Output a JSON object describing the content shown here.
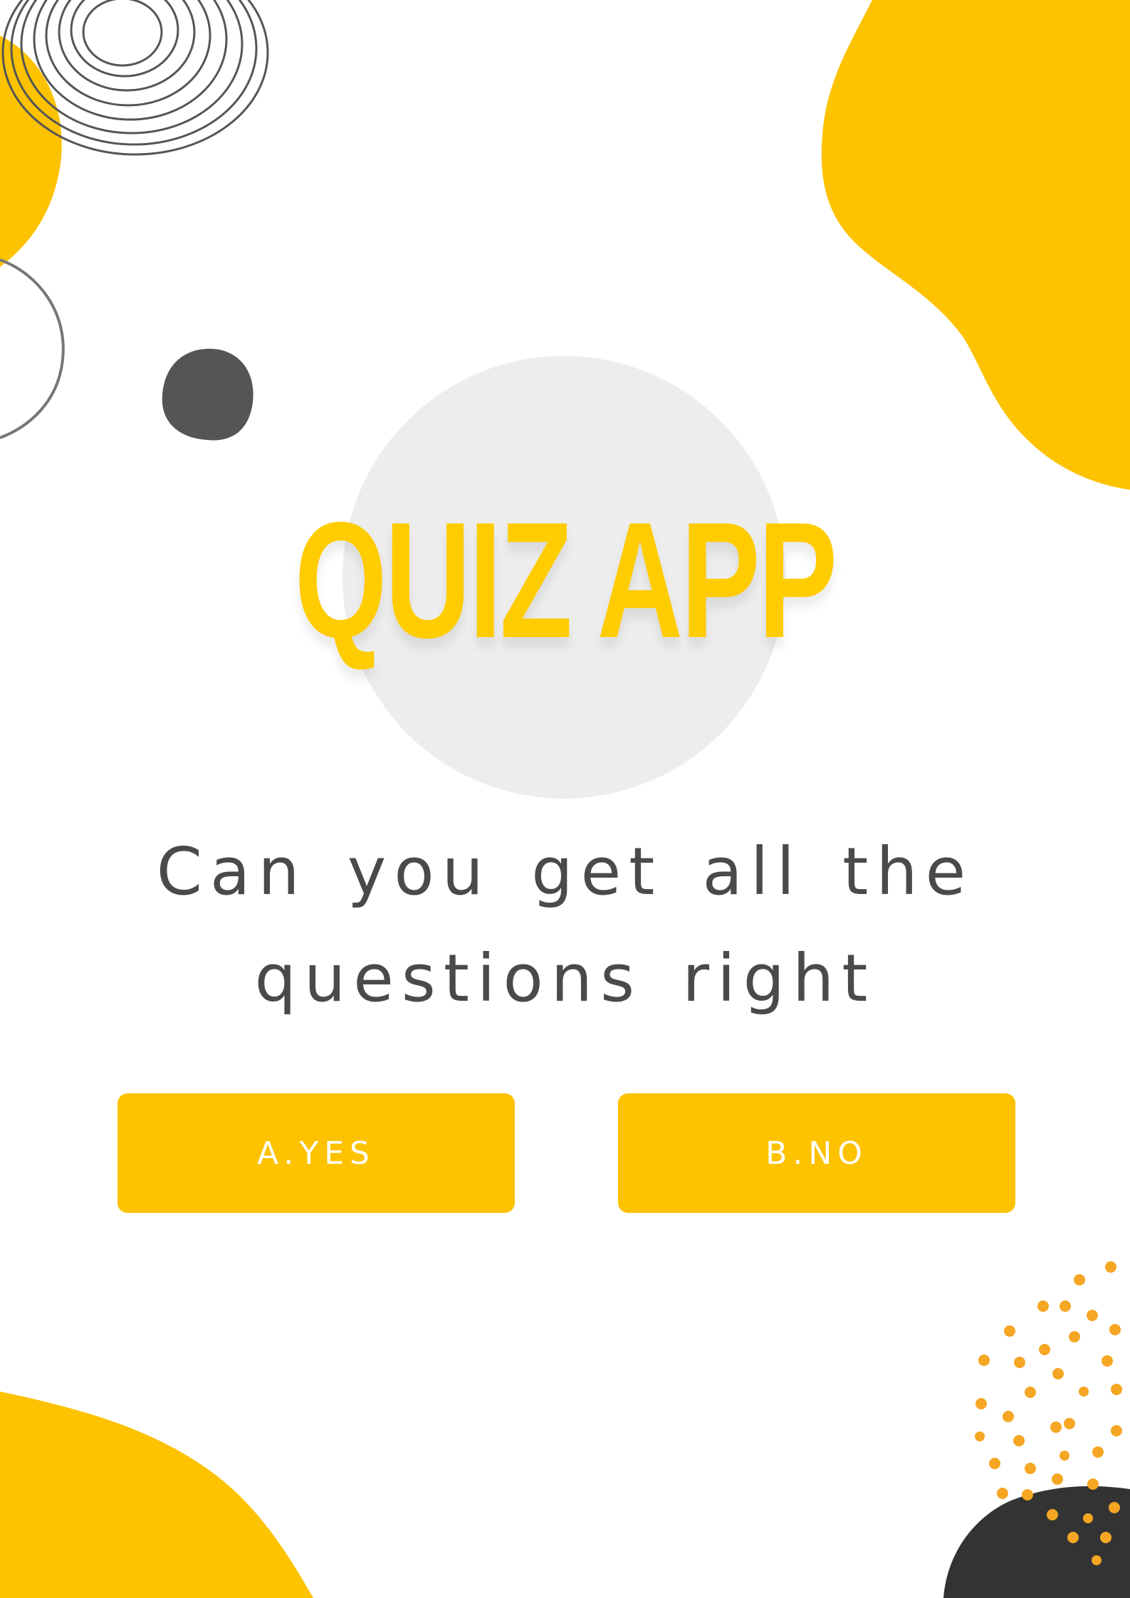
{
  "app": {
    "title": "QUIZ APP"
  },
  "question": {
    "line1": "Can you get all the",
    "line2": "questions right"
  },
  "answers": [
    {
      "label": "A.YES"
    },
    {
      "label": "B.NO"
    }
  ],
  "colors": {
    "background": "#ffffff",
    "accent": "#FDC200",
    "title": "#FFCC00",
    "button_text": "#ffffff",
    "text_dark": "#4a4a4a",
    "circle": "#EDEDED",
    "dots": "#F5A623",
    "dark_blob": "#333333"
  }
}
